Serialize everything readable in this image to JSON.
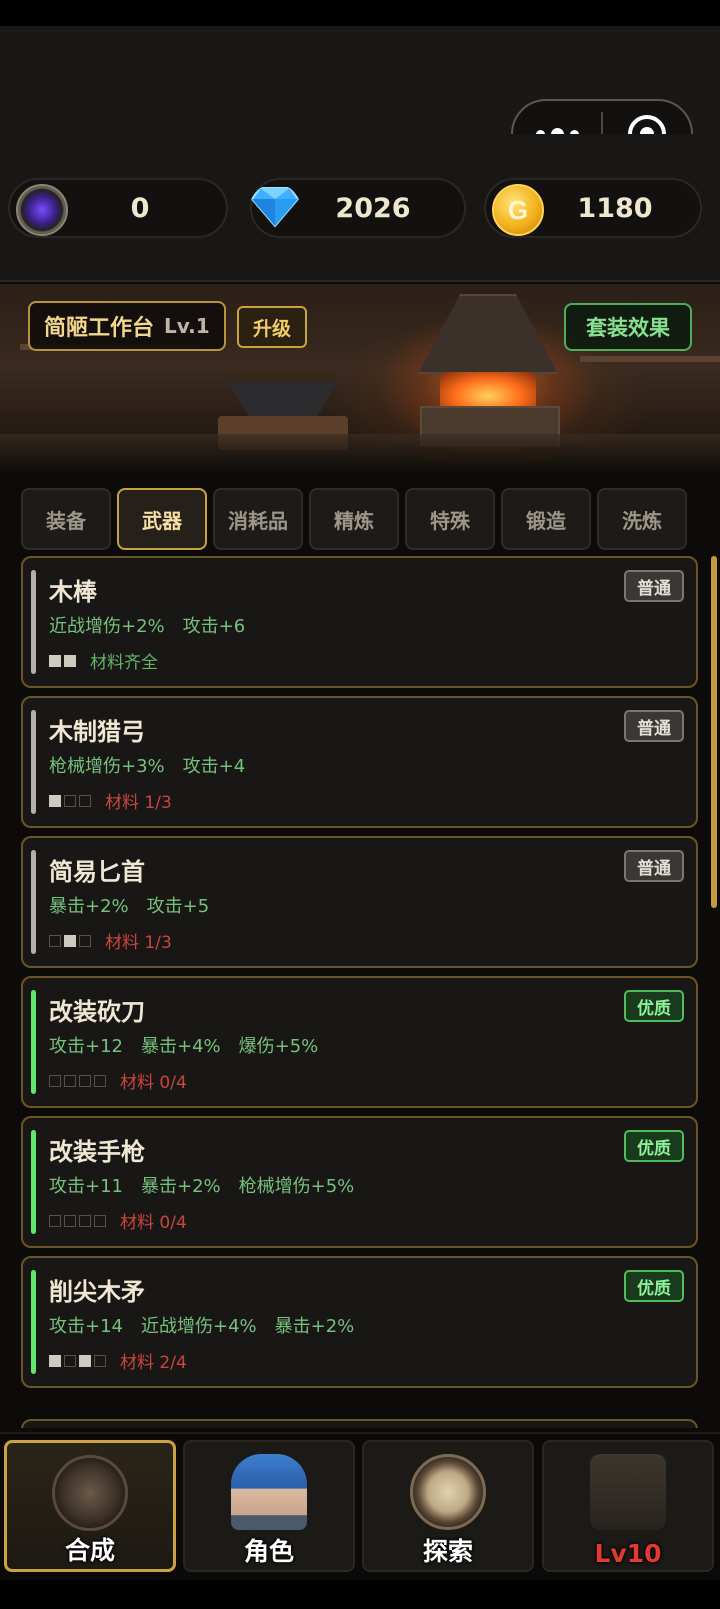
{
  "resources": [
    {
      "name": "purple-orb",
      "value": "0"
    },
    {
      "name": "diamond",
      "value": "2026"
    },
    {
      "name": "gold",
      "value": "1180",
      "icon_glyph": "G"
    }
  ],
  "workbench": {
    "name": "简陋工作台",
    "level": "Lv.1",
    "upgrade_label": "升级",
    "set_effect_label": "套装效果"
  },
  "tabs": [
    "装备",
    "武器",
    "消耗品",
    "精炼",
    "特殊",
    "锻造",
    "洗炼"
  ],
  "active_tab": "武器",
  "items": [
    {
      "name": "木棒",
      "stats": [
        "近战增伤+2%",
        "攻击+6"
      ],
      "rarity": "普通",
      "rarity_class": "normal",
      "slots": [
        1,
        1
      ],
      "material": "材料齐全",
      "material_ok": true
    },
    {
      "name": "木制猎弓",
      "stats": [
        "枪械增伤+3%",
        "攻击+4"
      ],
      "rarity": "普通",
      "rarity_class": "normal",
      "slots": [
        1,
        0,
        0
      ],
      "material": "材料 1/3",
      "material_ok": false
    },
    {
      "name": "简易匕首",
      "stats": [
        "暴击+2%",
        "攻击+5"
      ],
      "rarity": "普通",
      "rarity_class": "normal",
      "slots": [
        0,
        1,
        0
      ],
      "material": "材料 1/3",
      "material_ok": false
    },
    {
      "name": "改装砍刀",
      "stats": [
        "攻击+12",
        "暴击+4%",
        "爆伤+5%"
      ],
      "rarity": "优质",
      "rarity_class": "good",
      "slots": [
        0,
        0,
        0,
        0
      ],
      "material": "材料 0/4",
      "material_ok": false
    },
    {
      "name": "改装手枪",
      "stats": [
        "攻击+11",
        "暴击+2%",
        "枪械增伤+5%"
      ],
      "rarity": "优质",
      "rarity_class": "good",
      "slots": [
        0,
        0,
        0,
        0
      ],
      "material": "材料 0/4",
      "material_ok": false
    },
    {
      "name": "削尖木矛",
      "stats": [
        "攻击+14",
        "近战增伤+4%",
        "暴击+2%"
      ],
      "rarity": "优质",
      "rarity_class": "good",
      "slots": [
        1,
        0,
        1,
        0
      ],
      "material": "材料 2/4",
      "material_ok": false
    }
  ],
  "nav": [
    {
      "label": "合成",
      "icon": "crafting-icon",
      "active": true
    },
    {
      "label": "角色",
      "icon": "character-icon",
      "active": false
    },
    {
      "label": "探索",
      "icon": "compass-icon",
      "active": false
    },
    {
      "label": "Lv10",
      "icon": "shop-icon",
      "active": false,
      "locked": true
    }
  ],
  "colors": {
    "accent_gold": "#c9a244",
    "rarity_good": "#4fbd5b",
    "material_missing": "#c9453d",
    "material_ok": "#5eb467"
  }
}
